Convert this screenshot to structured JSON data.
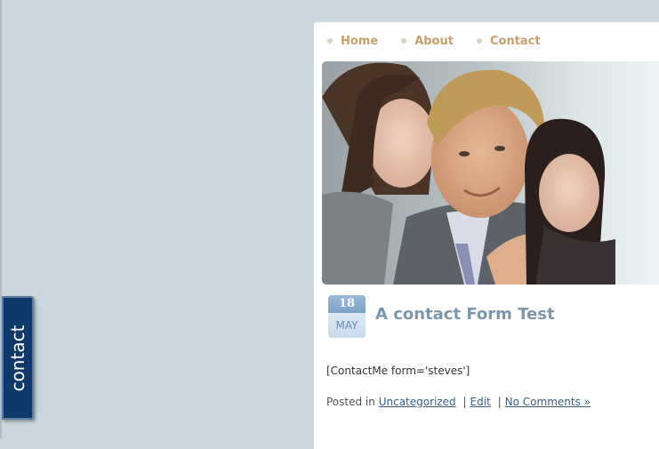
{
  "nav": {
    "items": [
      {
        "label": "Home"
      },
      {
        "label": "About"
      },
      {
        "label": "Contact"
      }
    ]
  },
  "post": {
    "date_day": "18",
    "date_month": "MAY",
    "title": "A contact Form Test",
    "body": "[ContactMe form='steves']",
    "meta": {
      "posted_in_prefix": "Posted in",
      "category": "Uncategorized",
      "edit": "Edit",
      "comments": "No Comments »",
      "separator": "|"
    }
  },
  "contact_tab": {
    "label": "contact"
  },
  "colors": {
    "page_background": "#c9d6dd",
    "nav_link": "#c5a06a",
    "title": "#7c96ab",
    "contact_tab": "#0e3a6b",
    "link": "#3a5f8c"
  },
  "hero_image": {
    "icon": "business-people-photo"
  }
}
